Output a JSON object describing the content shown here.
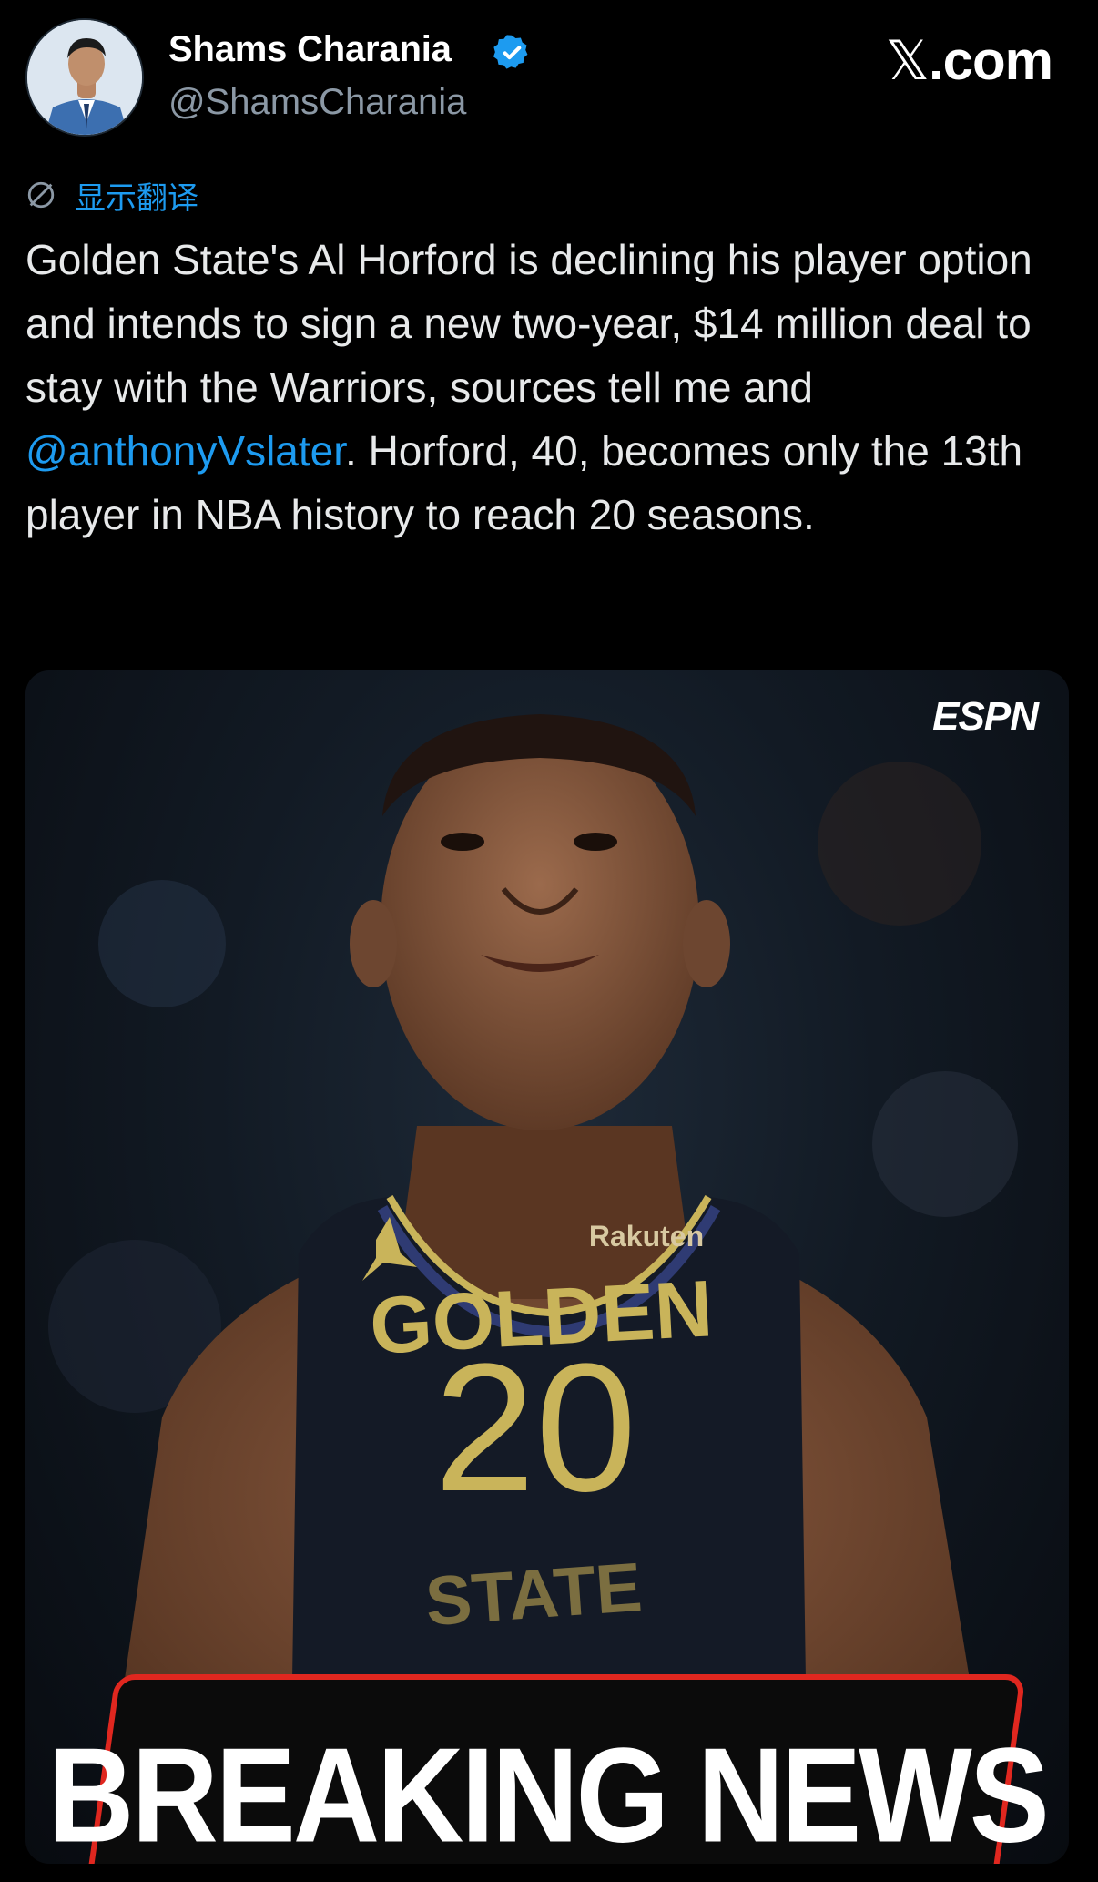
{
  "header": {
    "author_name": "Shams Charania",
    "handle": "@ShamsCharania",
    "site_label": "com",
    "site_glyph": "𝕏"
  },
  "translate": {
    "label": "显示翻译"
  },
  "tweet": {
    "text_part1": "Golden State's Al Horford is declining his player option and intends to sign a new two-year, $14 million deal to stay with the Warriors, sources tell me and ",
    "mention": "@anthonyVslater",
    "text_part2": ". Horford, 40, becomes only the 13th player in NBA history to reach 20 seasons."
  },
  "media": {
    "network_logo": "ESPN",
    "jersey_sponsor": "Rakuten",
    "jersey_top": "GOLDEN",
    "jersey_number": "20",
    "jersey_bottom": "STATE",
    "banner": "BREAKING NEWS"
  },
  "colors": {
    "background": "#000000",
    "text": "#e7e9ea",
    "secondary": "#8b98a5",
    "link": "#1d9bf0",
    "banner_red": "#e0271f",
    "jersey_gold": "#c9b45a"
  }
}
